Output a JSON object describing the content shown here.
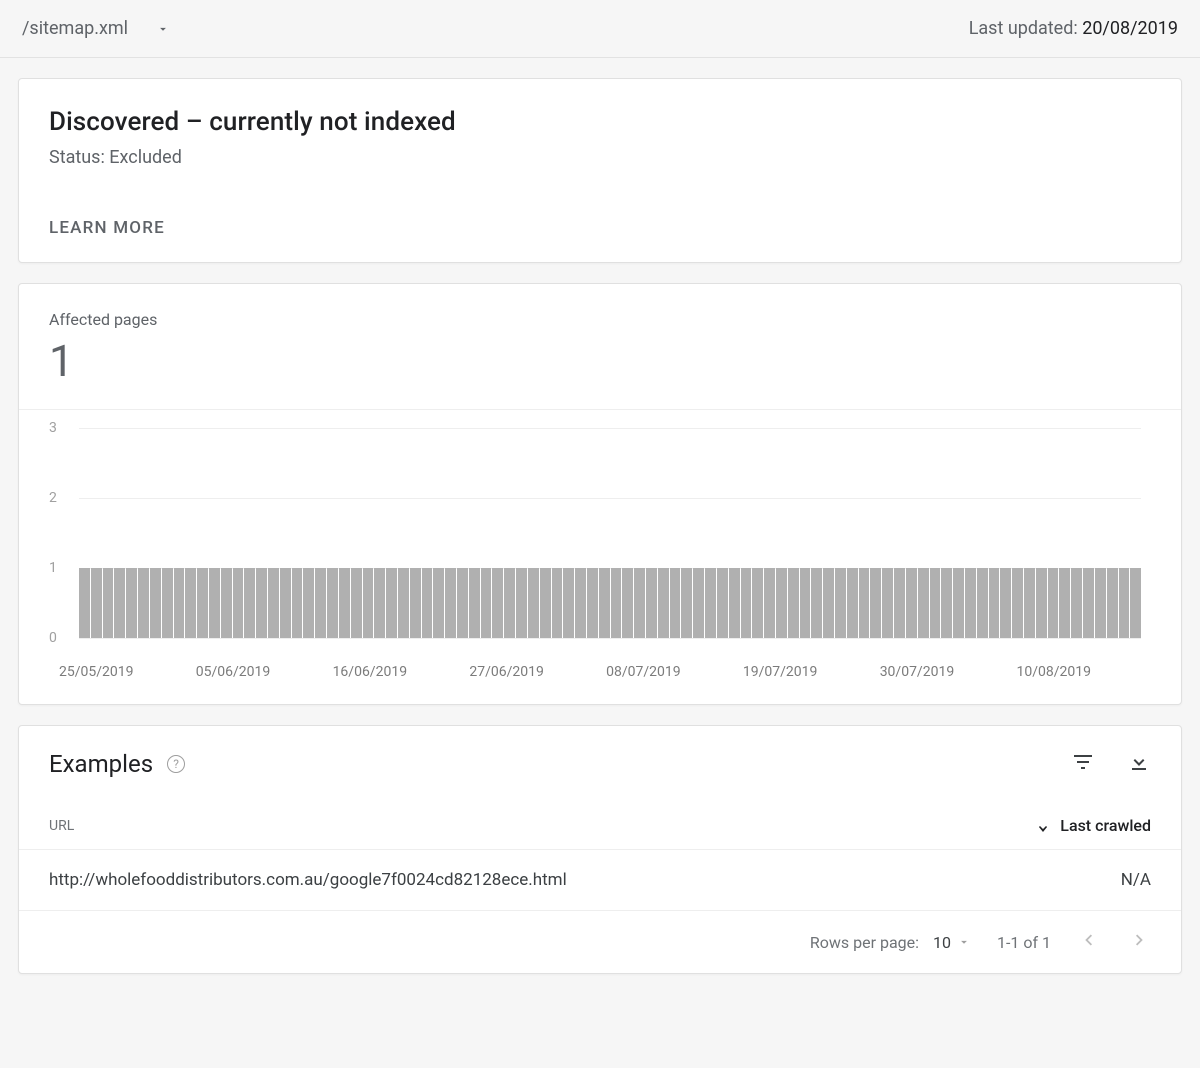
{
  "topbar": {
    "dropdown_label": "/sitemap.xml",
    "updated_label": "Last updated: ",
    "updated_date": "20/08/2019"
  },
  "status": {
    "title": "Discovered – currently not indexed",
    "subtitle": "Status: Excluded",
    "learn_more": "LEARN MORE"
  },
  "chart": {
    "affected_label": "Affected pages",
    "affected_count": "1"
  },
  "chart_data": {
    "type": "bar",
    "title": "Affected pages",
    "ylabel": "",
    "xlabel": "",
    "ylim": [
      0,
      3
    ],
    "y_ticks": [
      0,
      1,
      2,
      3
    ],
    "x_tick_labels": [
      "25/05/2019",
      "05/06/2019",
      "16/06/2019",
      "27/06/2019",
      "08/07/2019",
      "19/07/2019",
      "30/07/2019",
      "10/08/2019"
    ],
    "categories_count": 90,
    "series": [
      {
        "name": "Affected pages",
        "constant_value": 1,
        "length": 90
      }
    ]
  },
  "examples": {
    "title": "Examples",
    "columns": {
      "url": "URL",
      "last_crawled": "Last crawled"
    },
    "rows": [
      {
        "url": "http://wholefooddistributors.com.au/google7f0024cd82128ece.html",
        "last_crawled": "N/A"
      }
    ],
    "footer": {
      "rows_per_page_label": "Rows per page:",
      "rows_per_page_value": "10",
      "range": "1-1 of 1"
    }
  }
}
